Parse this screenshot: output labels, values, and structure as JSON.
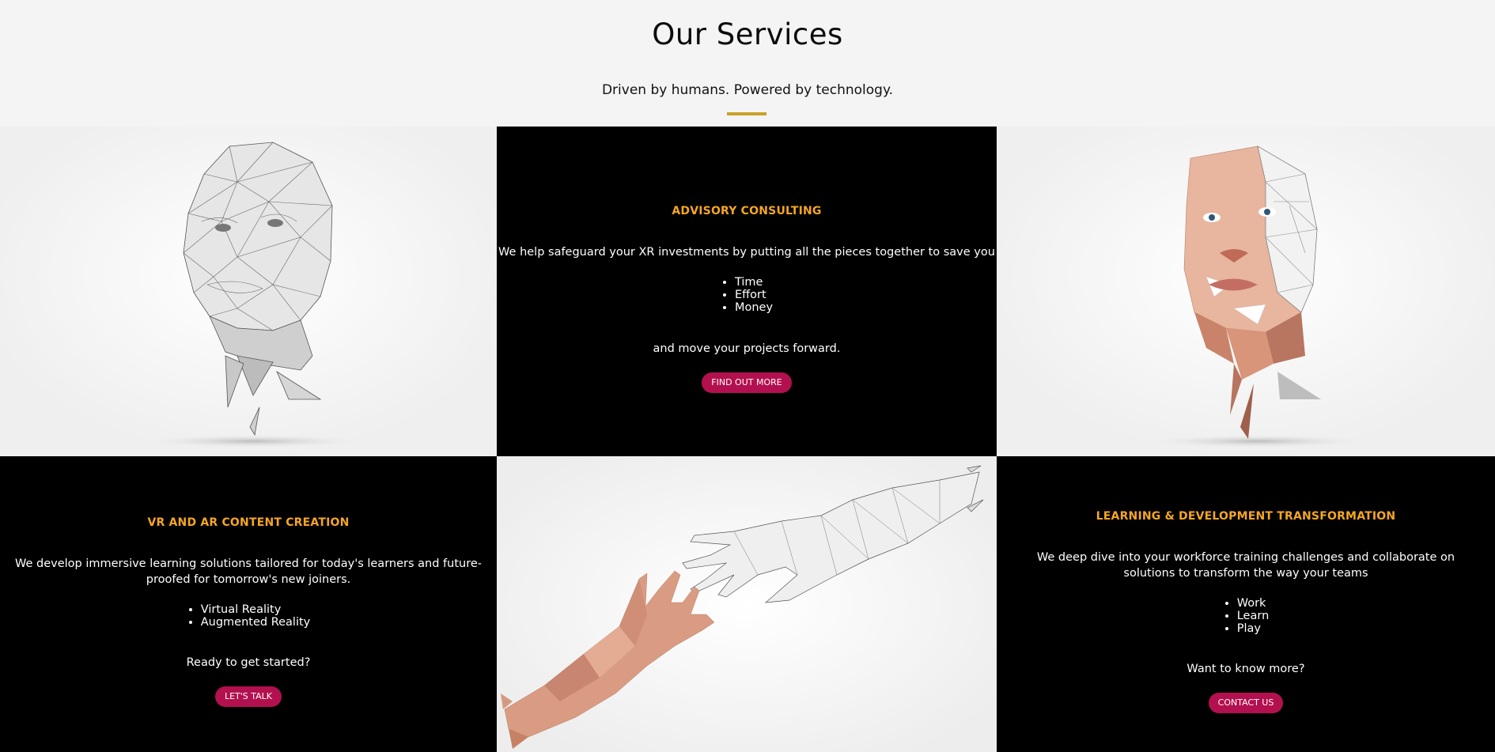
{
  "header": {
    "title": "Our Services",
    "tagline": "Driven by humans. Powered by technology."
  },
  "colors": {
    "accent_gold": "#c9a227",
    "heading_orange": "#f5a623",
    "button_crimson": "#b3104f"
  },
  "advisory": {
    "title": "ADVISORY CONSULTING",
    "intro": "We help safeguard your XR investments by putting all the pieces together to save you",
    "items": [
      "Time",
      "Effort",
      "Money"
    ],
    "outro": "and move your projects forward.",
    "button": "FIND OUT MORE"
  },
  "content": {
    "title": "VR AND AR CONTENT CREATION",
    "intro": "We develop immersive learning solutions tailored for today's learners and future-proofed for tomorrow's new joiners.",
    "items": [
      "Virtual Reality",
      "Augmented Reality"
    ],
    "outro": "Ready to get started?",
    "button": "LET'S TALK"
  },
  "learning": {
    "title": "LEARNING & DEVELOPMENT TRANSFORMATION",
    "intro": "We deep dive into your workforce training challenges and collaborate on solutions to transform the way your teams",
    "items": [
      "Work",
      "Learn",
      "Play"
    ],
    "outro": "Want to know more?",
    "button": "CONTACT US"
  },
  "images": {
    "wireframe_head": "wireframe-head-image",
    "polygon_face": "polygon-face-image",
    "reaching_hands": "reaching-hands-image"
  }
}
